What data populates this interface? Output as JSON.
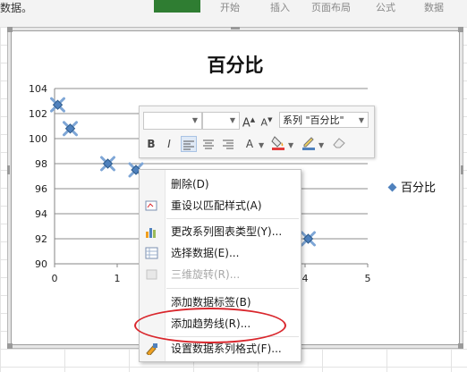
{
  "window": {
    "top_text": "数据。",
    "ribbon_tabs": [
      "开始",
      "插入",
      "页面布局",
      "公式",
      "数据"
    ]
  },
  "chart": {
    "title": "百分比",
    "legend": "百分比",
    "x_ticks": [
      "0",
      "1",
      "2",
      "3",
      "4",
      "5"
    ],
    "y_ticks": [
      "90",
      "92",
      "94",
      "96",
      "98",
      "100",
      "102",
      "104"
    ]
  },
  "chart_data": {
    "type": "scatter",
    "title": "百分比",
    "xlim": [
      0,
      5
    ],
    "ylim": [
      90,
      104
    ],
    "grid": true,
    "legend_position": "right",
    "series": [
      {
        "name": "百分比",
        "x": [
          0.05,
          0.25,
          0.85,
          1.3,
          2.3,
          3.6,
          4.05
        ],
        "y": [
          102.7,
          100.8,
          98,
          97.5,
          95.9,
          93.6,
          92
        ]
      }
    ],
    "series_color": "#4f81bd"
  },
  "mini_toolbar": {
    "series_select": "系列 \"百分比\"",
    "grow_font": "A",
    "shrink_font": "A",
    "bold": "B",
    "italic": "I",
    "font_color_label": "A"
  },
  "context_menu": {
    "items": [
      {
        "label": "删除(D)",
        "enabled": true
      },
      {
        "label": "重设以匹配样式(A)",
        "enabled": true
      },
      {
        "label": "更改系列图表类型(Y)...",
        "enabled": true
      },
      {
        "label": "选择数据(E)...",
        "enabled": true
      },
      {
        "label": "三维旋转(R)...",
        "enabled": false
      },
      {
        "label": "添加数据标签(B)",
        "enabled": true
      },
      {
        "label": "添加趋势线(R)...",
        "enabled": true
      },
      {
        "label": "设置数据系列格式(F)...",
        "enabled": true
      }
    ]
  },
  "colors": {
    "highlight": "#d9262c",
    "series": "#4f81bd",
    "ribbon_active": "#2f7d32"
  }
}
